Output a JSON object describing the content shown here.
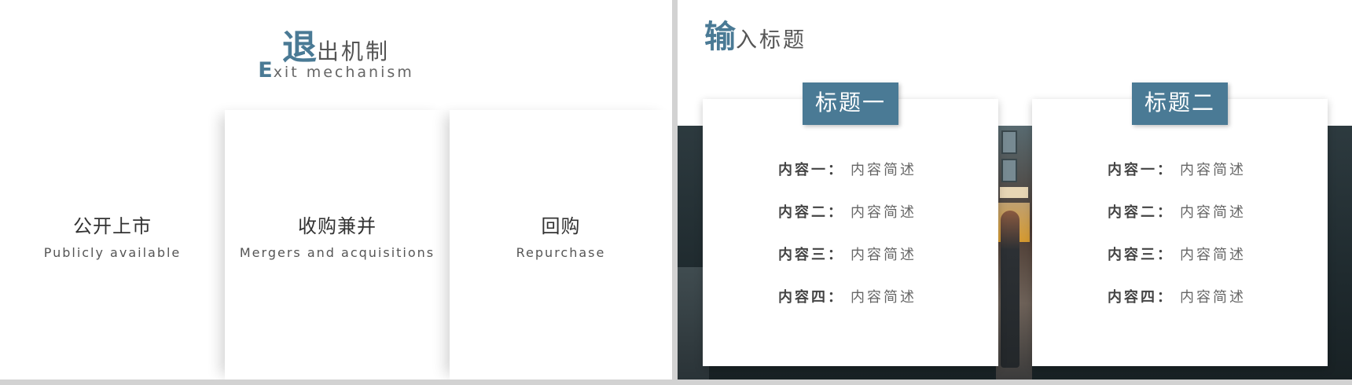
{
  "left_slide": {
    "title_big": "退",
    "title_rest": "出机制",
    "subtitle_cap": "E",
    "subtitle_rest": "xit mechanism",
    "panels": [
      {
        "title": "公开上市",
        "subtitle": "Publicly available"
      },
      {
        "title": "收购兼并",
        "subtitle": "Mergers and acquisitions"
      },
      {
        "title": "回购",
        "subtitle": "Repurchase"
      }
    ]
  },
  "right_slide": {
    "title_big": "输",
    "title_rest": "入标题",
    "cards": [
      {
        "tab": "标题一",
        "rows": [
          {
            "label": "内容一：",
            "value": "内容简述"
          },
          {
            "label": "内容二：",
            "value": "内容简述"
          },
          {
            "label": "内容三：",
            "value": "内容简述"
          },
          {
            "label": "内容四：",
            "value": "内容简述"
          }
        ]
      },
      {
        "tab": "标题二",
        "rows": [
          {
            "label": "内容一：",
            "value": "内容简述"
          },
          {
            "label": "内容二：",
            "value": "内容简述"
          },
          {
            "label": "内容三：",
            "value": "内容简述"
          },
          {
            "label": "内容四：",
            "value": "内容简述"
          }
        ]
      }
    ]
  },
  "colors": {
    "accent": "#4a7a95",
    "text": "#555555",
    "background": "#ffffff",
    "gap": "#d2d2d2"
  }
}
